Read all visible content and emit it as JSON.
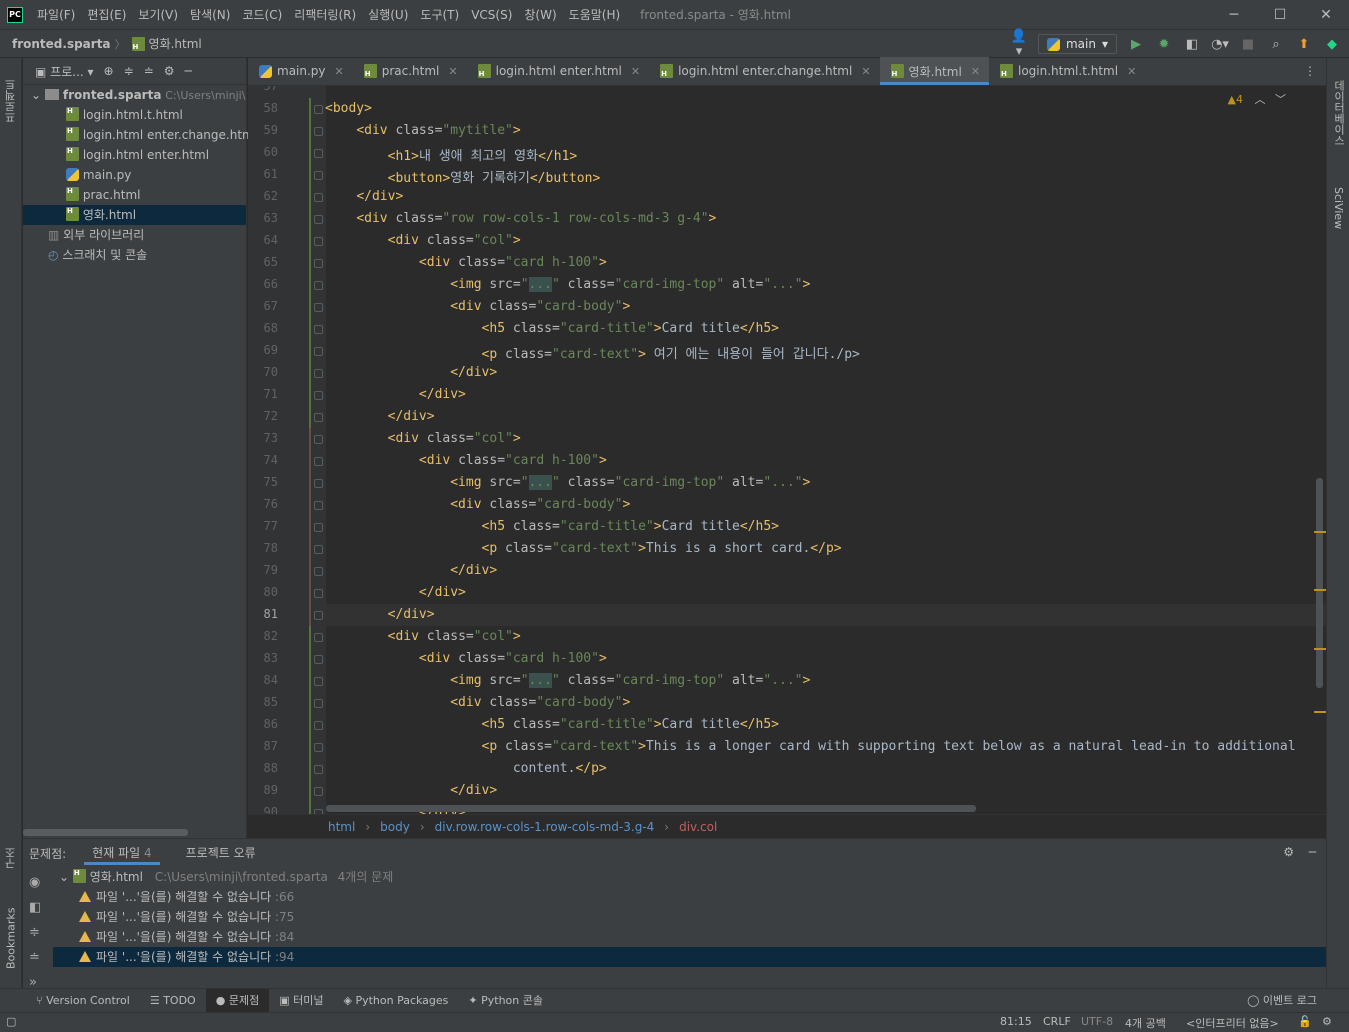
{
  "menubar": {
    "logo": "PC",
    "items": [
      "파일(F)",
      "편집(E)",
      "보기(V)",
      "탐색(N)",
      "코드(C)",
      "리팩터링(R)",
      "실행(U)",
      "도구(T)",
      "VCS(S)",
      "창(W)",
      "도움말(H)"
    ],
    "window_title": "fronted.sparta - 영화.html"
  },
  "navbar": {
    "project": "fronted.sparta",
    "file": "영화.html",
    "run_config": "main"
  },
  "project_panel": {
    "header": "프로...",
    "root": "fronted.sparta",
    "root_path": "C:\\Users\\minji\\",
    "files": [
      "login.html.t.html",
      "login.html enter.change.html",
      "login.html enter.html",
      "main.py",
      "prac.html",
      "영화.html"
    ],
    "selected_file": "영화.html",
    "external_libs": "외부 라이브러리",
    "scratches": "스크래치 및 콘솔"
  },
  "left_strip": {
    "project_tab": "프로젝트",
    "structure_tab": "구조",
    "bookmarks_tab": "Bookmarks"
  },
  "right_strip": {
    "database_tab": "데이터베이스",
    "sciview_tab": "SciView"
  },
  "tabs": [
    {
      "label": "main.py",
      "icon": "python",
      "active": false
    },
    {
      "label": "prac.html",
      "icon": "html",
      "active": false
    },
    {
      "label": "login.html enter.html",
      "icon": "html",
      "active": false
    },
    {
      "label": "login.html enter.change.html",
      "icon": "html",
      "active": false
    },
    {
      "label": "영화.html",
      "icon": "html",
      "active": true
    },
    {
      "label": "login.html.t.html",
      "icon": "html",
      "active": false
    }
  ],
  "editor": {
    "warning_count": "4",
    "current_line": "81",
    "line_numbers": [
      "57",
      "58",
      "59",
      "60",
      "61",
      "62",
      "63",
      "64",
      "65",
      "66",
      "67",
      "68",
      "69",
      "70",
      "71",
      "72",
      "73",
      "74",
      "75",
      "76",
      "77",
      "78",
      "79",
      "80",
      "81",
      "82",
      "83",
      "84",
      "85",
      "86",
      "87",
      "88",
      "89",
      "90"
    ],
    "lines": [
      [],
      [
        [
          "t",
          "<body>"
        ]
      ],
      [
        [
          "p",
          "    "
        ],
        [
          "t",
          "<div "
        ],
        [
          "a",
          "class="
        ],
        [
          "s",
          "\"mytitle\""
        ],
        [
          "t",
          ">"
        ]
      ],
      [
        [
          "p",
          "        "
        ],
        [
          "t",
          "<h1>"
        ],
        [
          "p",
          "내 생애 최고의 영화"
        ],
        [
          "t",
          "</h1>"
        ]
      ],
      [
        [
          "p",
          "        "
        ],
        [
          "t",
          "<button>"
        ],
        [
          "p",
          "영화 기록하기"
        ],
        [
          "t",
          "</button>"
        ]
      ],
      [
        [
          "p",
          "    "
        ],
        [
          "t",
          "</div>"
        ]
      ],
      [
        [
          "p",
          "    "
        ],
        [
          "t",
          "<div "
        ],
        [
          "a",
          "class="
        ],
        [
          "s",
          "\"row row-cols-1 row-cols-md-3 g-4\""
        ],
        [
          "t",
          ">"
        ]
      ],
      [
        [
          "p",
          "        "
        ],
        [
          "t",
          "<div "
        ],
        [
          "a",
          "class="
        ],
        [
          "s",
          "\"col\""
        ],
        [
          "t",
          ">"
        ]
      ],
      [
        [
          "p",
          "            "
        ],
        [
          "t",
          "<div "
        ],
        [
          "a",
          "class="
        ],
        [
          "s",
          "\"card h-100\""
        ],
        [
          "t",
          ">"
        ]
      ],
      [
        [
          "p",
          "                "
        ],
        [
          "t",
          "<img "
        ],
        [
          "a",
          "src="
        ],
        [
          "s",
          "\""
        ],
        [
          "h",
          "..."
        ],
        [
          "s",
          "\" "
        ],
        [
          "a",
          "class="
        ],
        [
          "s",
          "\"card-img-top\" "
        ],
        [
          "a",
          "alt="
        ],
        [
          "s",
          "\"...\""
        ],
        [
          "t",
          ">"
        ]
      ],
      [
        [
          "p",
          "                "
        ],
        [
          "t",
          "<div "
        ],
        [
          "a",
          "class="
        ],
        [
          "s",
          "\"card-body\""
        ],
        [
          "t",
          ">"
        ]
      ],
      [
        [
          "p",
          "                    "
        ],
        [
          "t",
          "<h5 "
        ],
        [
          "a",
          "class="
        ],
        [
          "s",
          "\"card-title\""
        ],
        [
          "t",
          ">"
        ],
        [
          "p",
          "Card title"
        ],
        [
          "t",
          "</h5>"
        ]
      ],
      [
        [
          "p",
          "                    "
        ],
        [
          "t",
          "<p "
        ],
        [
          "a",
          "class="
        ],
        [
          "s",
          "\"card-text\""
        ],
        [
          "t",
          ">"
        ],
        [
          "p",
          " 여기 에는 내용이 들어 갑니다./p>"
        ]
      ],
      [
        [
          "p",
          "                "
        ],
        [
          "t",
          "</div>"
        ]
      ],
      [
        [
          "p",
          "            "
        ],
        [
          "t",
          "</div>"
        ]
      ],
      [
        [
          "p",
          "        "
        ],
        [
          "t",
          "</div>"
        ]
      ],
      [
        [
          "p",
          "        "
        ],
        [
          "t",
          "<div "
        ],
        [
          "a",
          "class="
        ],
        [
          "s",
          "\"col\""
        ],
        [
          "t",
          ">"
        ]
      ],
      [
        [
          "p",
          "            "
        ],
        [
          "t",
          "<div "
        ],
        [
          "a",
          "class="
        ],
        [
          "s",
          "\"card h-100\""
        ],
        [
          "t",
          ">"
        ]
      ],
      [
        [
          "p",
          "                "
        ],
        [
          "t",
          "<img "
        ],
        [
          "a",
          "src="
        ],
        [
          "s",
          "\""
        ],
        [
          "h",
          "..."
        ],
        [
          "s",
          "\" "
        ],
        [
          "a",
          "class="
        ],
        [
          "s",
          "\"card-img-top\" "
        ],
        [
          "a",
          "alt="
        ],
        [
          "s",
          "\"...\""
        ],
        [
          "t",
          ">"
        ]
      ],
      [
        [
          "p",
          "                "
        ],
        [
          "t",
          "<div "
        ],
        [
          "a",
          "class="
        ],
        [
          "s",
          "\"card-body\""
        ],
        [
          "t",
          ">"
        ]
      ],
      [
        [
          "p",
          "                    "
        ],
        [
          "t",
          "<h5 "
        ],
        [
          "a",
          "class="
        ],
        [
          "s",
          "\"card-title\""
        ],
        [
          "t",
          ">"
        ],
        [
          "p",
          "Card title"
        ],
        [
          "t",
          "</h5>"
        ]
      ],
      [
        [
          "p",
          "                    "
        ],
        [
          "t",
          "<p "
        ],
        [
          "a",
          "class="
        ],
        [
          "s",
          "\"card-text\""
        ],
        [
          "t",
          ">"
        ],
        [
          "p",
          "This is a short card."
        ],
        [
          "t",
          "</p>"
        ]
      ],
      [
        [
          "p",
          "                "
        ],
        [
          "t",
          "</div>"
        ]
      ],
      [
        [
          "p",
          "            "
        ],
        [
          "t",
          "</div>"
        ]
      ],
      [
        [
          "p",
          "        "
        ],
        [
          "t",
          "</div>"
        ]
      ],
      [
        [
          "p",
          "        "
        ],
        [
          "t",
          "<div "
        ],
        [
          "a",
          "class="
        ],
        [
          "s",
          "\"col\""
        ],
        [
          "t",
          ">"
        ]
      ],
      [
        [
          "p",
          "            "
        ],
        [
          "t",
          "<div "
        ],
        [
          "a",
          "class="
        ],
        [
          "s",
          "\"card h-100\""
        ],
        [
          "t",
          ">"
        ]
      ],
      [
        [
          "p",
          "                "
        ],
        [
          "t",
          "<img "
        ],
        [
          "a",
          "src="
        ],
        [
          "s",
          "\""
        ],
        [
          "h",
          "..."
        ],
        [
          "s",
          "\" "
        ],
        [
          "a",
          "class="
        ],
        [
          "s",
          "\"card-img-top\" "
        ],
        [
          "a",
          "alt="
        ],
        [
          "s",
          "\"...\""
        ],
        [
          "t",
          ">"
        ]
      ],
      [
        [
          "p",
          "                "
        ],
        [
          "t",
          "<div "
        ],
        [
          "a",
          "class="
        ],
        [
          "s",
          "\"card-body\""
        ],
        [
          "t",
          ">"
        ]
      ],
      [
        [
          "p",
          "                    "
        ],
        [
          "t",
          "<h5 "
        ],
        [
          "a",
          "class="
        ],
        [
          "s",
          "\"card-title\""
        ],
        [
          "t",
          ">"
        ],
        [
          "p",
          "Card title"
        ],
        [
          "t",
          "</h5>"
        ]
      ],
      [
        [
          "p",
          "                    "
        ],
        [
          "t",
          "<p "
        ],
        [
          "a",
          "class="
        ],
        [
          "s",
          "\"card-text\""
        ],
        [
          "t",
          ">"
        ],
        [
          "p",
          "This is a longer card with supporting text below as a natural lead-in to additional"
        ]
      ],
      [
        [
          "p",
          "                        content."
        ],
        [
          "t",
          "</p>"
        ]
      ],
      [
        [
          "p",
          "                "
        ],
        [
          "t",
          "</div>"
        ]
      ],
      [
        [
          "p",
          "            "
        ],
        [
          "t",
          "</div>"
        ]
      ]
    ]
  },
  "breadcrumb": [
    "html",
    "body",
    "div.row.row-cols-1.row-cols-md-3.g-4",
    "div.col"
  ],
  "problems": {
    "label": "문제점:",
    "tab_current": "현재 파일",
    "tab_current_count": "4",
    "tab_project": "프로젝트 오류",
    "file": "영화.html",
    "file_path": "C:\\Users\\minji\\fronted.sparta",
    "summary": "4개의 문제",
    "items": [
      {
        "text": "파일 '...'을(를) 해결할 수 없습니다",
        "line": ":66"
      },
      {
        "text": "파일 '...'을(를) 해결할 수 없습니다",
        "line": ":75"
      },
      {
        "text": "파일 '...'을(를) 해결할 수 없습니다",
        "line": ":84"
      },
      {
        "text": "파일 '...'을(를) 해결할 수 없습니다",
        "line": ":94"
      }
    ]
  },
  "bottom_tabs": [
    "Version Control",
    "TODO",
    "문제점",
    "터미널",
    "Python Packages",
    "Python 콘솔"
  ],
  "event_log": "이벤트 로그",
  "status": {
    "position": "81:15",
    "line_sep": "CRLF",
    "encoding": "UTF-8",
    "indent": "4개 공백",
    "interpreter": "<인터프리터 없음>"
  }
}
